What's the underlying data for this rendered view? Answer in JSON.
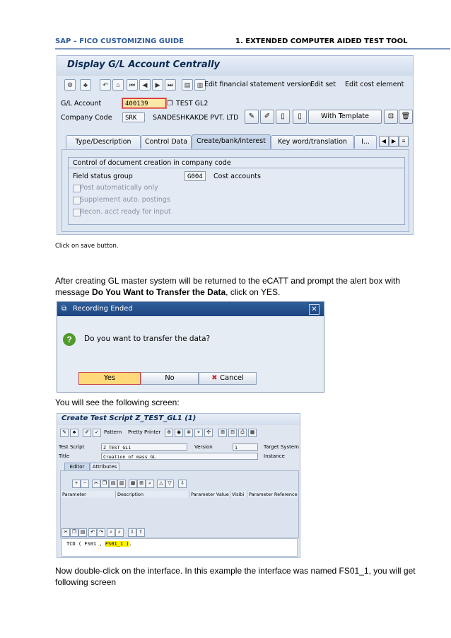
{
  "header": {
    "left": "SAP – FICO CUSTOMIZING GUIDE",
    "right_num": "1",
    "right_text": ". EXTENDED COMPUTER AIDED TEST TOOL"
  },
  "shot1": {
    "title": "Display G/L Account Centrally",
    "toolbar": {
      "edit_fs_version": "Edit financial statement version",
      "edit_set": "Edit set",
      "edit_cost_element": "Edit cost element"
    },
    "gl_account_label": "G/L Account",
    "gl_account_value": "400139",
    "gl_account_text": "TEST GL2",
    "company_code_label": "Company Code",
    "company_code_value": "SRK",
    "company_code_text": "SANDESHKAKDE PVT. LTD",
    "with_template": "With Template",
    "tabs": [
      "Type/Description",
      "Control Data",
      "Create/bank/interest",
      "Key word/translation",
      "I..."
    ],
    "group_title": "Control of document creation in company code",
    "field_status_group_label": "Field status group",
    "field_status_group_value": "G004",
    "field_status_group_text": "Cost accounts",
    "checkboxes": [
      "Post automatically only",
      "Supplement auto. postings",
      "Recon. acct ready for input"
    ]
  },
  "text1": "Click on save button.",
  "text2_a": " After creating GL master system will be returned to the eCATT and prompt the alert box with message ",
  "text2_bold": "Do You Want to Transfer the Data",
  "text2_b": ", click on YES.",
  "dialog": {
    "title": "Recording Ended",
    "message": "Do you want to transfer the data?",
    "yes": "Yes",
    "no": "No",
    "cancel": "Cancel"
  },
  "text3": "You will see the following screen:",
  "shot3": {
    "title": "Create Test Script Z_TEST_GL1 (1)",
    "pattern": "Pattern",
    "pretty_printer": "Pretty Printer",
    "test_script_label": "Test Script",
    "test_script_value": "Z_TEST_GL1",
    "version_label": "Version",
    "version_value": "1",
    "target_system_label": "Target System",
    "title_label": "Title",
    "title_value": "Creation of mass GL",
    "instance_label": "Instance",
    "tabs": [
      "Editor",
      "Attributes"
    ],
    "columns": [
      "Parameter",
      "Description",
      "Parameter Value",
      "Visibi",
      "Parameter Reference"
    ],
    "code_prefix": "TCD ( FS01 , ",
    "code_highlight": "FS01_1 )",
    "code_suffix": "."
  },
  "text4": "Now double-click on the interface. In this example the interface was named FS01_1, you will get following screen"
}
